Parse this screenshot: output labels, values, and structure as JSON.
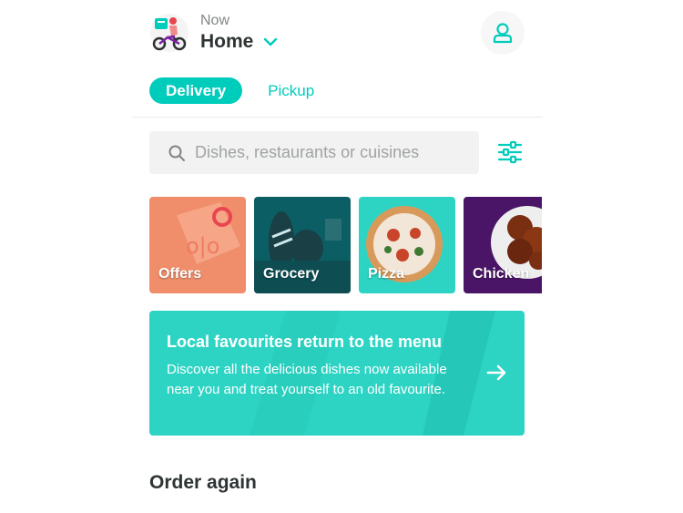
{
  "header": {
    "when": "Now",
    "location": "Home"
  },
  "tabs": [
    {
      "label": "Delivery",
      "active": true
    },
    {
      "label": "Pickup",
      "active": false
    }
  ],
  "search": {
    "placeholder": "Dishes, restaurants or cuisines",
    "value": ""
  },
  "categories": [
    {
      "label": "Offers",
      "icon": "offers-tag"
    },
    {
      "label": "Grocery",
      "icon": "grocery-bag"
    },
    {
      "label": "Pizza",
      "icon": "pizza-photo"
    },
    {
      "label": "Chicken",
      "icon": "chicken-photo"
    }
  ],
  "banner": {
    "title": "Local favourites return to the menu",
    "body": "Discover all the delicious dishes now available near you and treat yourself to an old favourite."
  },
  "order_again": {
    "title": "Order again"
  },
  "colors": {
    "accent": "#00ccbc",
    "banner": "#2dd4c4",
    "text": "#2e3333",
    "muted": "#828585"
  }
}
